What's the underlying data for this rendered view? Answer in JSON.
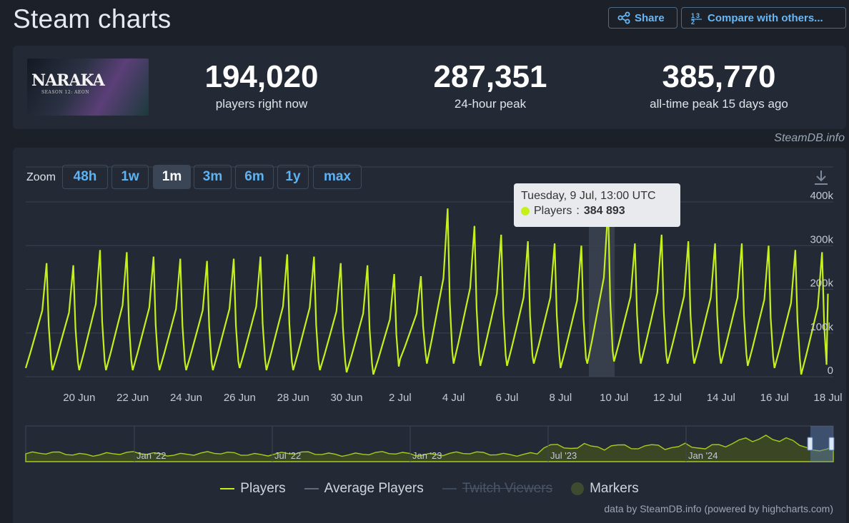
{
  "header": {
    "title": "Steam charts",
    "share_label": "Share",
    "compare_label": "Compare with others..."
  },
  "game": {
    "logo_text": "NARAKA",
    "logo_sub": "SEASON 12: AEON"
  },
  "stats": [
    {
      "value": "194,020",
      "label": "players right now"
    },
    {
      "value": "287,351",
      "label": "24-hour peak"
    },
    {
      "value": "385,770",
      "label": "all-time peak 15 days ago"
    }
  ],
  "credit_top": "SteamDB.info",
  "zoom": {
    "label": "Zoom",
    "options": [
      "48h",
      "1w",
      "1m",
      "3m",
      "6m",
      "1y",
      "max"
    ],
    "active": "1m"
  },
  "tooltip": {
    "date": "Tuesday, 9 Jul, 13:00 UTC",
    "series": "Players",
    "value": "384 893"
  },
  "legend": {
    "players": "Players",
    "average": "Average Players",
    "twitch": "Twitch Viewers",
    "markers": "Markers"
  },
  "credit_bottom": "data by SteamDB.info (powered by highcharts.com)",
  "colors": {
    "accent": "#c6f01c",
    "link": "#5fb2f2",
    "background": "#1b2029",
    "panel": "#232a35"
  },
  "chart_data": {
    "type": "line",
    "title": "",
    "xlabel": "",
    "ylabel": "",
    "ylim": [
      0,
      400000
    ],
    "y_ticks": [
      "0",
      "100k",
      "200k",
      "300k",
      "400k"
    ],
    "x_ticks": [
      "20 Jun",
      "22 Jun",
      "24 Jun",
      "26 Jun",
      "28 Jun",
      "30 Jun",
      "2 Jul",
      "4 Jul",
      "6 Jul",
      "8 Jul",
      "10 Jul",
      "12 Jul",
      "14 Jul",
      "16 Jul",
      "18 Jul"
    ],
    "x_range_days": [
      18.0,
      48.2
    ],
    "series": [
      {
        "name": "Players",
        "daily_peaks": [
          260000,
          255000,
          290000,
          285000,
          275000,
          270000,
          265000,
          270000,
          275000,
          280000,
          275000,
          260000,
          255000,
          235000,
          230000,
          385000,
          345000,
          325000,
          310000,
          305000,
          300000,
          388000,
          305000,
          325000,
          310000,
          305000,
          305000,
          300000,
          290000,
          285000
        ],
        "daily_lows": [
          20000,
          15000,
          15000,
          15000,
          15000,
          15000,
          15000,
          15000,
          20000,
          15000,
          15000,
          15000,
          10000,
          5000,
          40000,
          30000,
          30000,
          25000,
          25000,
          30000,
          20000,
          30000,
          35000,
          30000,
          30000,
          30000,
          30000,
          25000,
          20000,
          5000
        ]
      }
    ],
    "highlight": {
      "date": "Tuesday, 9 Jul, 13:00 UTC",
      "value": 384893
    },
    "navigator_labels": [
      "Jan '22",
      "Jul '22",
      "Jan '23",
      "Jul '23",
      "Jan '24"
    ],
    "grid": true,
    "legend_position": "bottom"
  }
}
